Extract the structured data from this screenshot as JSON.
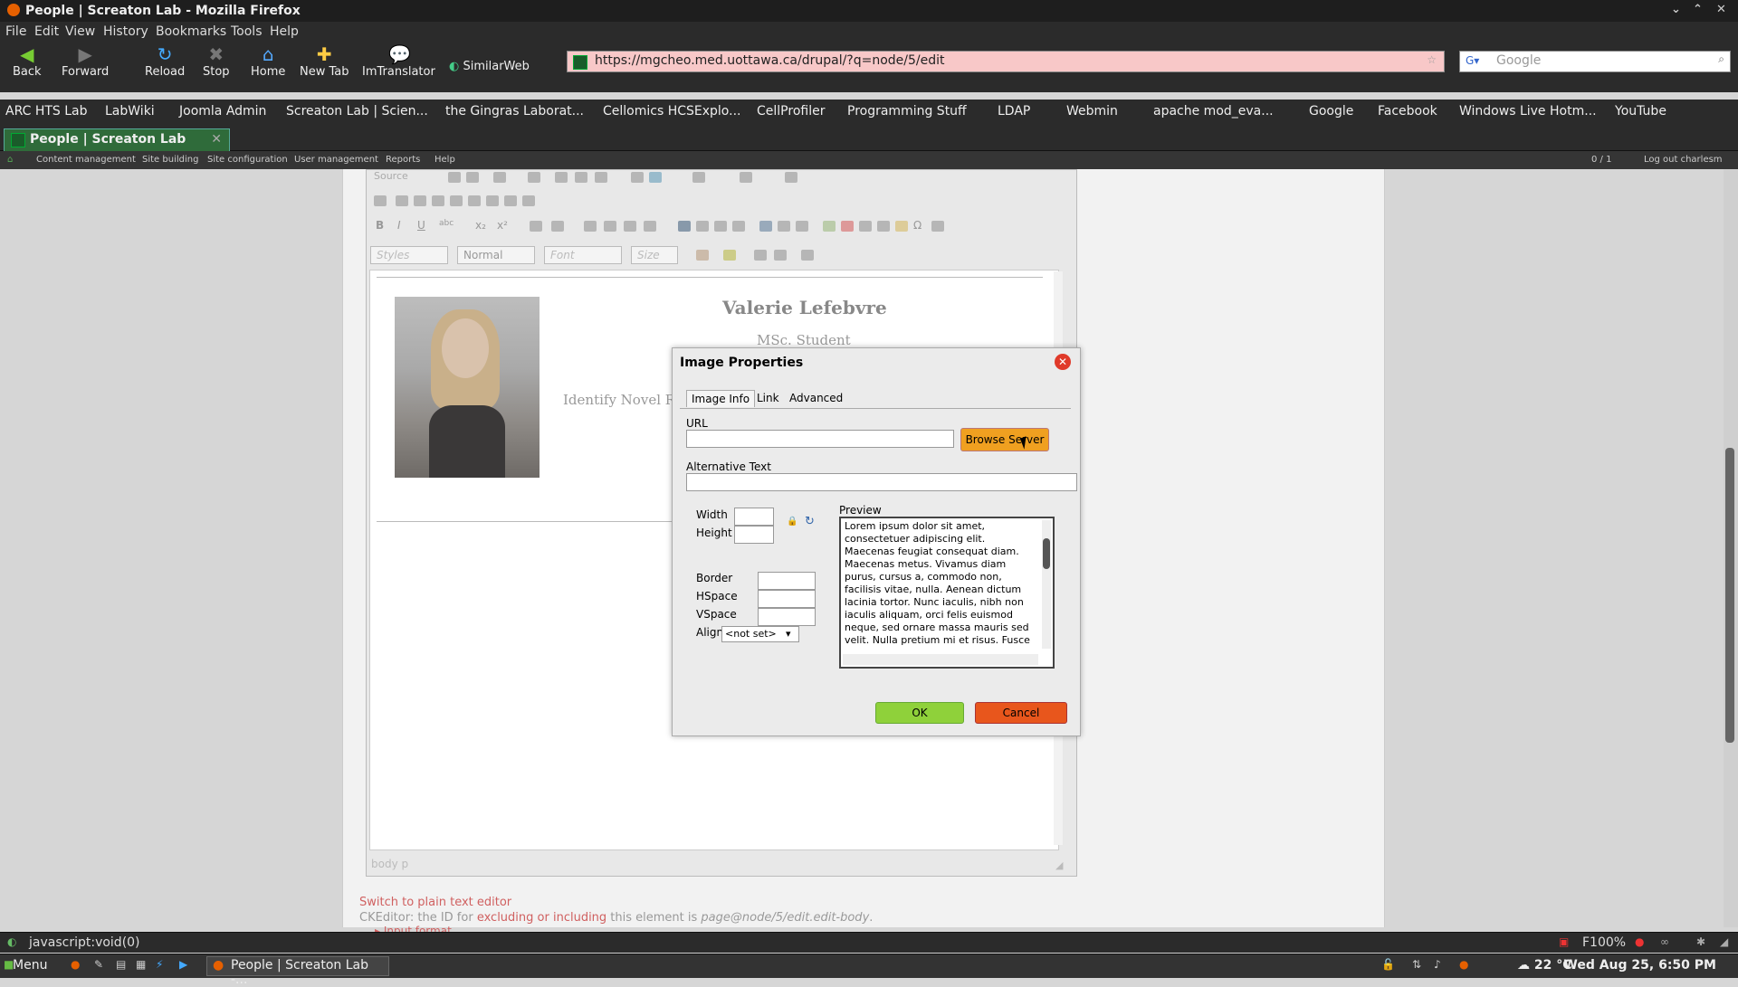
{
  "window": {
    "title": "People | Screaton Lab - Mozilla Firefox"
  },
  "menubar": [
    "File",
    "Edit",
    "View",
    "History",
    "Bookmarks",
    "Tools",
    "Help"
  ],
  "nav": {
    "back": "Back",
    "forward": "Forward",
    "reload": "Reload",
    "stop": "Stop",
    "home": "Home",
    "new_tab": "New Tab",
    "imtranslator": "ImTranslator",
    "similarweb": "SimilarWeb"
  },
  "url": "https://mgcheo.med.uottawa.ca/drupal/?q=node/5/edit",
  "search": {
    "placeholder": "Google"
  },
  "bookmarks": [
    "ARC HTS Lab",
    "LabWiki",
    "Joomla Admin",
    "Screaton Lab | Scien...",
    "the Gingras Laborat...",
    "Cellomics HCSExplo...",
    "CellProfiler",
    "Programming Stuff",
    "LDAP",
    "Webmin",
    "apache mod_eva...",
    "Google",
    "Facebook",
    "Windows Live Hotm...",
    "YouTube"
  ],
  "tab": {
    "title": "People | Screaton Lab"
  },
  "admin_menu": [
    "Content management",
    "Site building",
    "Site configuration",
    "User management",
    "Reports",
    "Help"
  ],
  "admin_right": {
    "count": "0 / 1",
    "logout": "Log out charlesm"
  },
  "editor": {
    "source_label": "Source",
    "styles": "Styles",
    "format": "Normal",
    "font": "Font",
    "size": "Size",
    "name": "Valerie Lefebvre",
    "subtitle": "MSc. Student",
    "identify_text": "Identify Novel Re",
    "path": "body  p"
  },
  "dialog": {
    "title": "Image Properties",
    "tabs": [
      "Image Info",
      "Link",
      "Advanced"
    ],
    "url_label": "URL",
    "url_value": "",
    "browse_server": "Browse Server",
    "alt_label": "Alternative Text",
    "width_label": "Width",
    "height_label": "Height",
    "border_label": "Border",
    "hspace_label": "HSpace",
    "vspace_label": "VSpace",
    "align_label": "Align",
    "align_value": "<not set>",
    "preview_label": "Preview",
    "preview_text": "Lorem ipsum dolor sit amet, consectetuer adipiscing elit. Maecenas feugiat consequat diam. Maecenas metus. Vivamus diam purus, cursus a, commodo non, facilisis vitae, nulla. Aenean dictum lacinia tortor. Nunc iaculis, nibh non iaculis aliquam, orci felis euismod neque, sed ornare massa mauris sed velit. Nulla pretium mi et risus. Fusce mi pede, tempor id,",
    "ok": "OK",
    "cancel": "Cancel"
  },
  "below_editor": {
    "switch": "Switch to plain text editor",
    "ck_prefix": "CKEditor: the ID for ",
    "ck_link": "excluding or including",
    "ck_mid": " this element is ",
    "ck_id": "page@node/5/edit.edit-body",
    "ck_end": ".",
    "input_format": "Input format"
  },
  "status": {
    "text": "javascript:void(0)",
    "zoom": "F100%"
  },
  "taskbar": {
    "menu": "Menu",
    "task": "People | Screaton Lab -...",
    "weather": "22 °C",
    "clock": "Wed Aug 25,  6:50 PM"
  }
}
